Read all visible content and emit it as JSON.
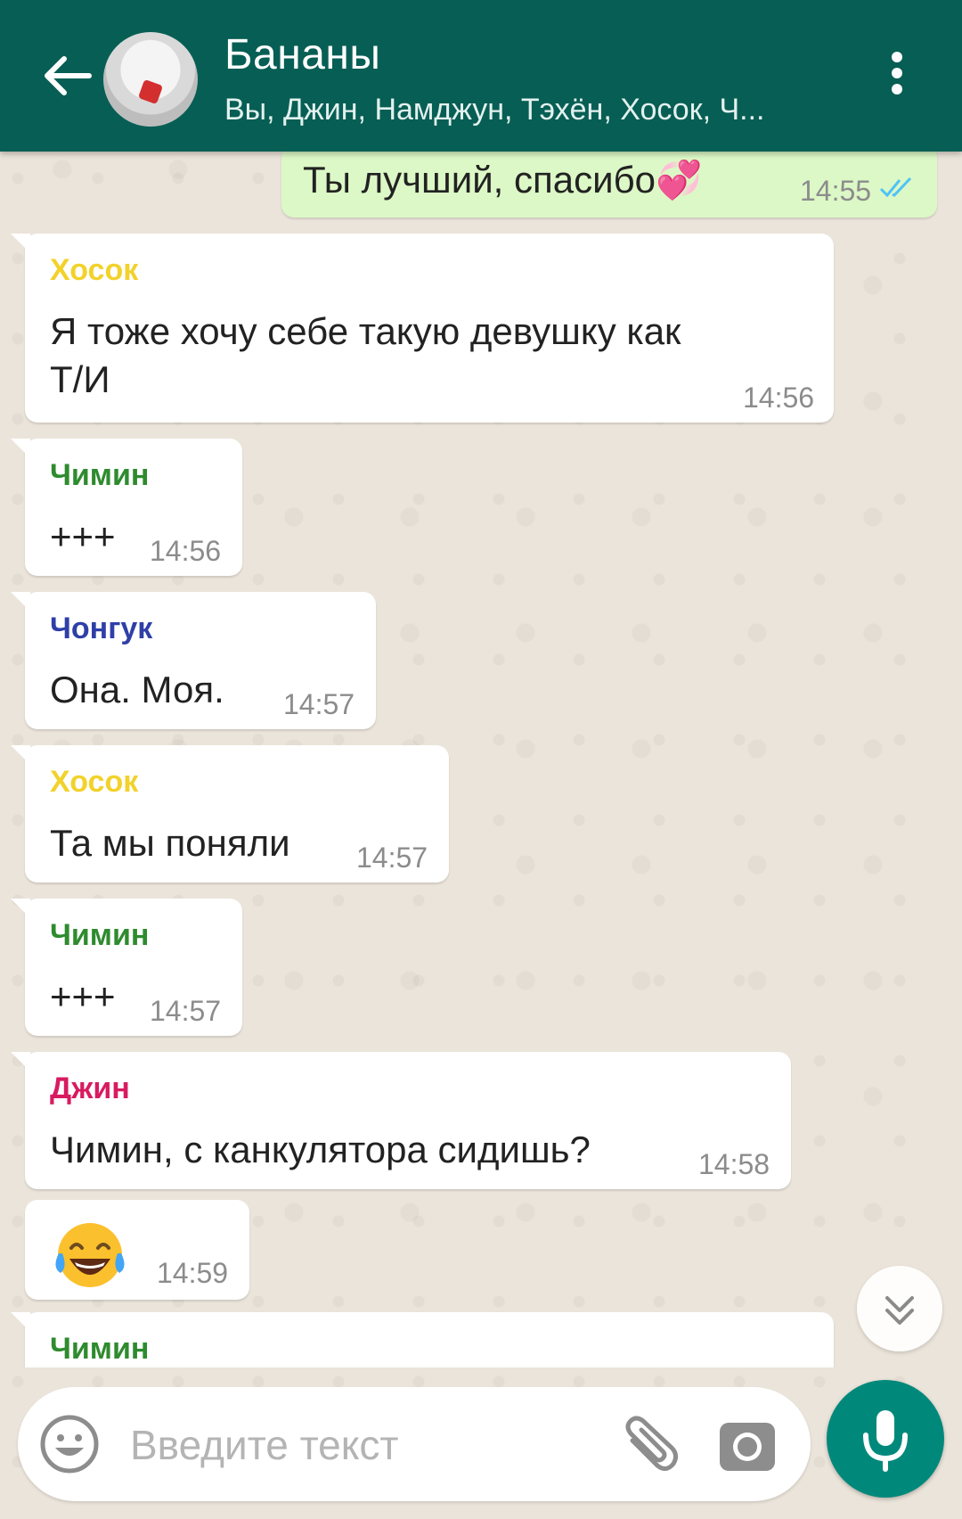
{
  "header": {
    "title": "Бананы",
    "subtitle": "Вы, Джин, Намджун, Тэхён, Хосок, Ч..."
  },
  "messages": [
    {
      "type": "out",
      "text": "Ты лучший, спасибо💞",
      "time": "14:55"
    },
    {
      "type": "in",
      "sender": "Хосок",
      "sender_color": "#f2d22b",
      "text_line1": "Я тоже хочу себе такую девушку как",
      "text_line2": "Т/И",
      "time": "14:56"
    },
    {
      "type": "in",
      "sender": "Чимин",
      "sender_color": "#2e8b2e",
      "text": "+++",
      "time": "14:56"
    },
    {
      "type": "in",
      "sender": "Чонгук",
      "sender_color": "#2f3fa8",
      "text": "Она. Моя.",
      "time": "14:57"
    },
    {
      "type": "in",
      "sender": "Хосок",
      "sender_color": "#f2d22b",
      "text": "Та мы поняли",
      "time": "14:57"
    },
    {
      "type": "in",
      "sender": "Чимин",
      "sender_color": "#2e8b2e",
      "text": "+++",
      "time": "14:57"
    },
    {
      "type": "in",
      "sender": "Джин",
      "sender_color": "#d81b60",
      "text": "Чимин, с канкулятора сидишь?",
      "time": "14:58"
    },
    {
      "type": "in",
      "emoji": "face-with-tears-of-joy",
      "time": "14:59"
    },
    {
      "type": "in",
      "sender": "Чимин",
      "sender_color": "#2e8b2e"
    }
  ],
  "composer": {
    "placeholder": "Введите текст"
  },
  "colors": {
    "header": "#075e54",
    "outgoing_bubble": "#dcf8c6",
    "incoming_bubble": "#ffffff",
    "mic_button": "#00897b",
    "read_ticks": "#4fc3f7"
  },
  "icons": [
    "back-arrow-icon",
    "group-avatar",
    "more-vert-icon",
    "double-check-icon",
    "scroll-down-icon",
    "emoji-icon",
    "attach-icon",
    "camera-icon",
    "mic-icon"
  ]
}
